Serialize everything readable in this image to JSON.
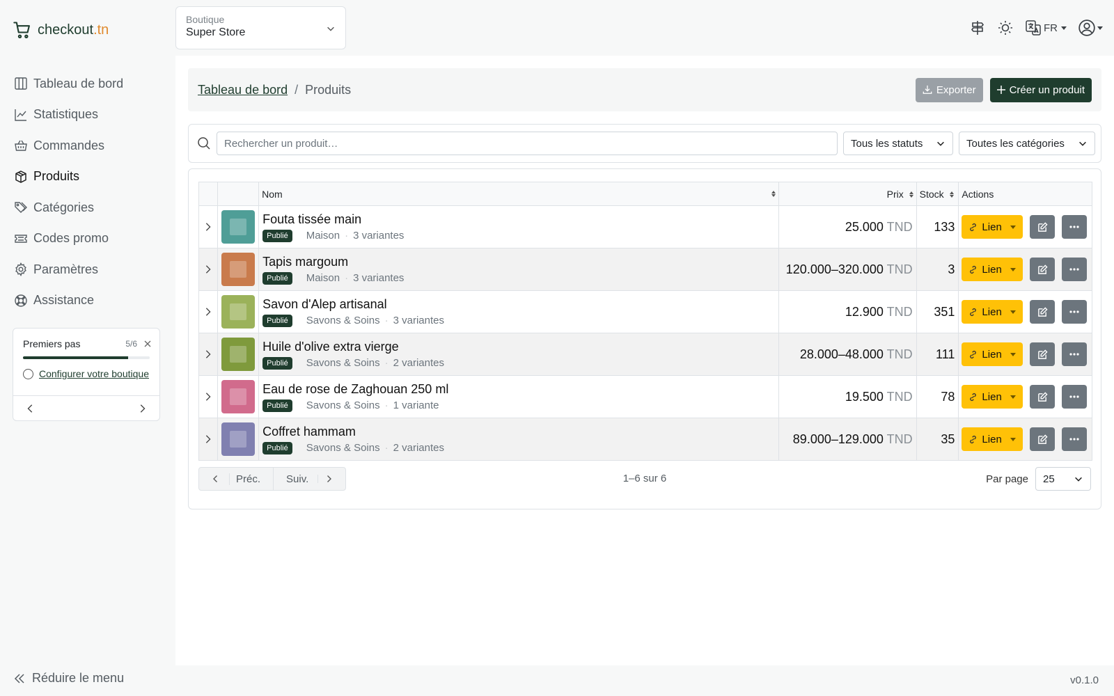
{
  "brand": {
    "name": "checkout",
    "tld": ".tn"
  },
  "store": {
    "label": "Boutique",
    "value": "Super Store"
  },
  "lang": "FR",
  "nav": [
    {
      "label": "Tableau de bord",
      "icon": "columns-icon",
      "active": false
    },
    {
      "label": "Statistiques",
      "icon": "chart-line-icon",
      "active": false
    },
    {
      "label": "Commandes",
      "icon": "basket-icon",
      "active": false
    },
    {
      "label": "Produits",
      "icon": "box-icon",
      "active": true
    },
    {
      "label": "Catégories",
      "icon": "tags-icon",
      "active": false
    },
    {
      "label": "Codes promo",
      "icon": "ticket-icon",
      "active": false
    },
    {
      "label": "Paramètres",
      "icon": "gear-icon",
      "active": false
    },
    {
      "label": "Assistance",
      "icon": "lifebuoy-icon",
      "active": false
    }
  ],
  "onboarding": {
    "title": "Premiers pas",
    "count": "5/6",
    "progress": 0.83,
    "step": "Configurer votre boutique"
  },
  "footer": {
    "collapse": "Réduire le menu",
    "version": "v0.1.0"
  },
  "breadcrumb": {
    "home": "Tableau de bord",
    "sep": "/",
    "current": "Produits"
  },
  "actions": {
    "export": "Exporter",
    "create": "Créer un produit"
  },
  "filters": {
    "search_placeholder": "Rechercher un produit…",
    "status": "Tous les statuts",
    "category": "Toutes les catégories"
  },
  "table": {
    "headers": {
      "name": "Nom",
      "price": "Prix",
      "stock": "Stock",
      "actions": "Actions"
    },
    "link_label": "Lien",
    "currency": "TND",
    "rows": [
      {
        "name": "Fouta tissée main",
        "status": "Publié",
        "category": "Maison",
        "variants": "3 variantes",
        "price": "25.000",
        "stock": "133",
        "thumb": "#4f9e97"
      },
      {
        "name": "Tapis margoum",
        "status": "Publié",
        "category": "Maison",
        "variants": "3 variantes",
        "price": "120.000–320.000",
        "stock": "3",
        "thumb": "#c97b4c"
      },
      {
        "name": "Savon d'Alep artisanal",
        "status": "Publié",
        "category": "Savons & Soins",
        "variants": "3 variantes",
        "price": "12.900",
        "stock": "351",
        "thumb": "#9bb25a"
      },
      {
        "name": "Huile d'olive extra vierge",
        "status": "Publié",
        "category": "Savons & Soins",
        "variants": "2 variantes",
        "price": "28.000–48.000",
        "stock": "111",
        "thumb": "#7f9a3c"
      },
      {
        "name": "Eau de rose de Zaghouan 250 ml",
        "status": "Publié",
        "category": "Savons & Soins",
        "variants": "1 variante",
        "price": "19.500",
        "stock": "78",
        "thumb": "#d16b8c"
      },
      {
        "name": "Coffret hammam",
        "status": "Publié",
        "category": "Savons & Soins",
        "variants": "2 variantes",
        "price": "89.000–129.000",
        "stock": "35",
        "thumb": "#8080b0"
      }
    ]
  },
  "pagination": {
    "prev": "Préc.",
    "next": "Suiv.",
    "range": "1–6 sur 6",
    "per_page_label": "Par page",
    "per_page": "25"
  }
}
